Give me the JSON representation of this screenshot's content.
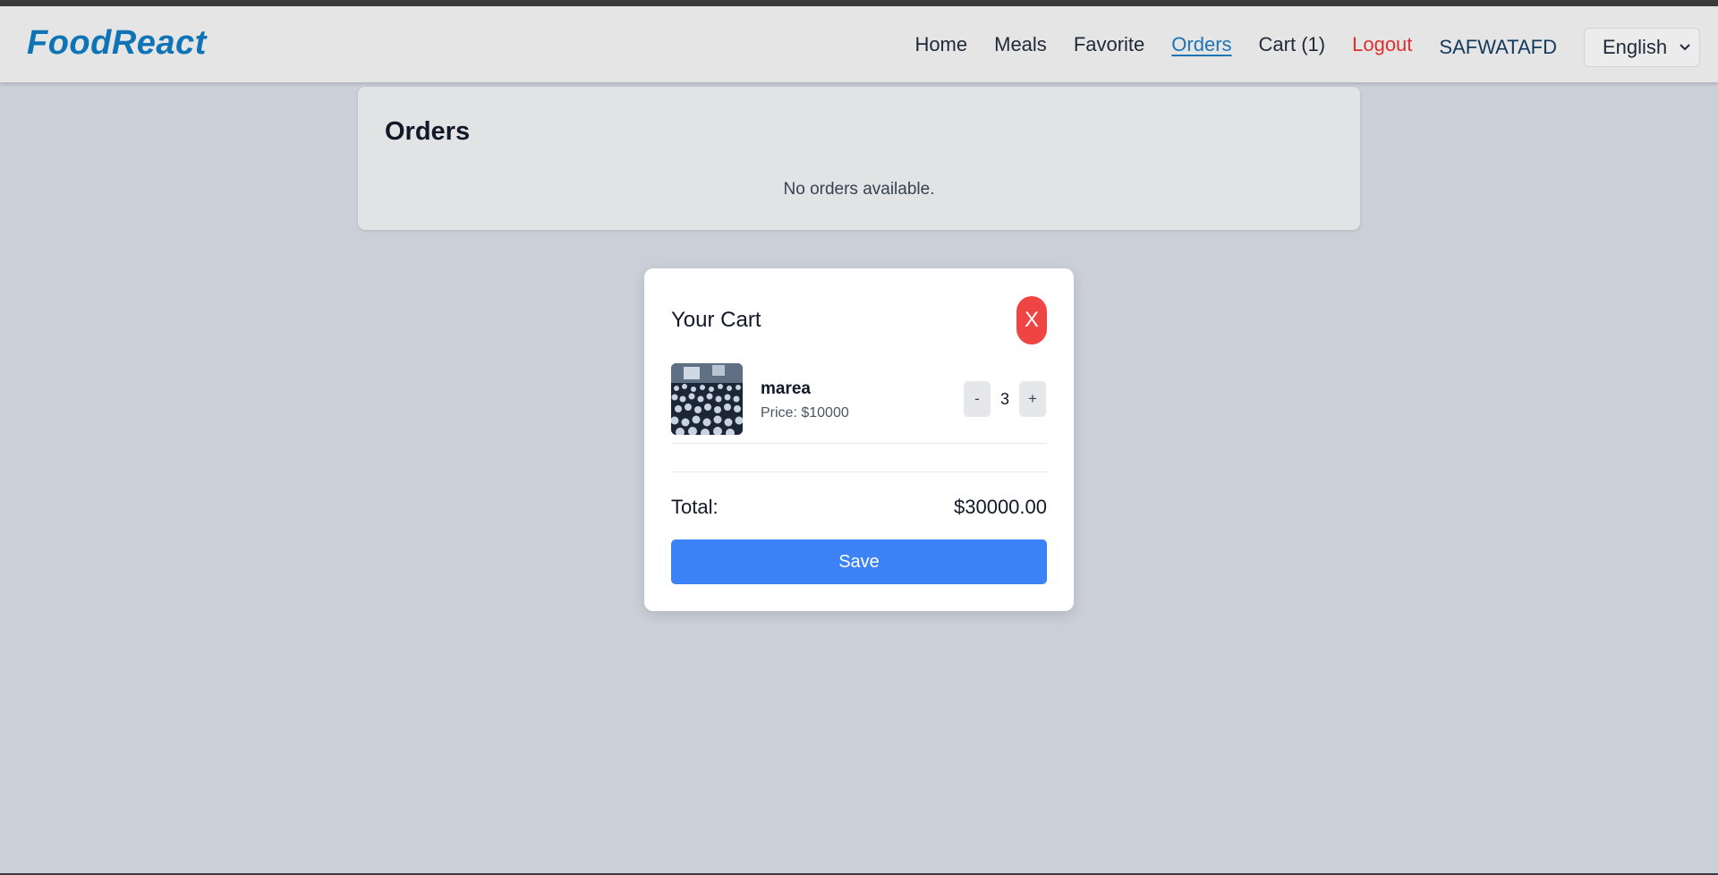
{
  "app": {
    "brand": "FoodReact"
  },
  "nav": {
    "items": [
      {
        "label": "Home",
        "active": false
      },
      {
        "label": "Meals",
        "active": false
      },
      {
        "label": "Favorite",
        "active": false
      },
      {
        "label": "Orders",
        "active": true
      },
      {
        "label": "Cart (1)",
        "active": false
      },
      {
        "label": "Logout",
        "active": false
      }
    ],
    "username": "SAFWATAFD",
    "language": {
      "selected": "English",
      "icon": "chevron-down-icon"
    }
  },
  "orders": {
    "title": "Orders",
    "empty_message": "No orders available."
  },
  "cart": {
    "title": "Your Cart",
    "close_label": "X",
    "items": [
      {
        "name": "marea",
        "price_text": "Price: $10000",
        "quantity": "3",
        "decrement_label": "-",
        "increment_label": "+"
      }
    ],
    "total_label": "Total:",
    "total_value": "$30000.00",
    "save_label": "Save"
  },
  "colors": {
    "brand": "#0f74b5",
    "active_link": "#1d74b5",
    "logout": "#dc2f2f",
    "close_button": "#ef4444",
    "save_button": "#3b82f6",
    "page_bg": "#cbcfd8"
  }
}
